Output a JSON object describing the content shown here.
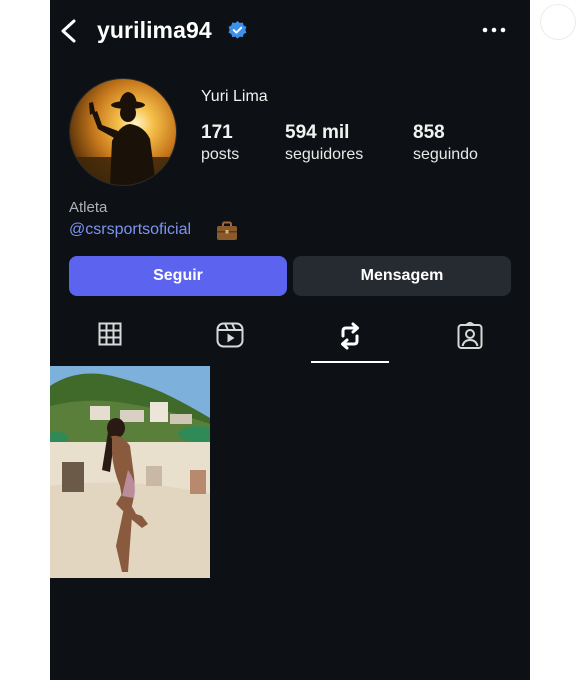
{
  "header": {
    "username": "yurilima94",
    "back_icon": "chevron-left-icon",
    "verified_icon": "verified-badge-icon",
    "more_icon": "more-horizontal-icon"
  },
  "profile": {
    "display_name": "Yuri Lima",
    "stats": [
      {
        "value": "171",
        "label": "posts"
      },
      {
        "value": "594 mil",
        "label": "seguidores"
      },
      {
        "value": "858",
        "label": "seguindo"
      }
    ],
    "category": "Atleta",
    "link": "@csrsportsoficial",
    "link_icon": "briefcase-icon"
  },
  "actions": {
    "follow_label": "Seguir",
    "message_label": "Mensagem"
  },
  "tabs": [
    {
      "name": "grid",
      "icon": "grid-icon",
      "selected": false
    },
    {
      "name": "reels",
      "icon": "reels-icon",
      "selected": false
    },
    {
      "name": "reposts",
      "icon": "repost-icon",
      "selected": true
    },
    {
      "name": "tagged",
      "icon": "tagged-person-icon",
      "selected": false
    }
  ],
  "posts": [
    {
      "icon": "beach-photo"
    }
  ],
  "colors": {
    "background": "#0d1014",
    "follow_button": "#5b63ef",
    "message_button": "#262a31",
    "link": "#7c95f5",
    "verified": "#3d8fe8"
  }
}
